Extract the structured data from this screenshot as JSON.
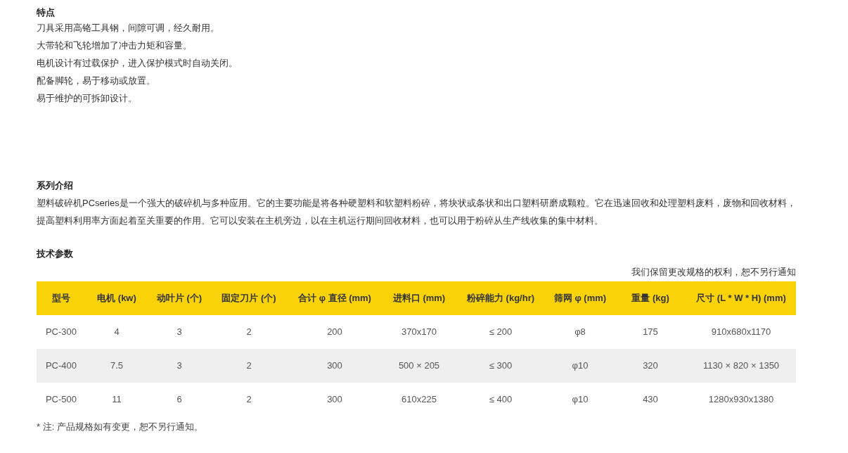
{
  "features": {
    "heading": "特点",
    "items": [
      "刀具采用高铬工具钢，间隙可调，经久耐用。",
      "大带轮和飞轮增加了冲击力矩和容量。",
      "电机设计有过载保护，进入保护模式时自动关闭。",
      "配备脚轮，易于移动或放置。",
      "易于维护的可拆卸设计。"
    ]
  },
  "intro": {
    "heading": "系列介绍",
    "text": "塑料破碎机PCseries是一个强大的破碎机与多种应用。它的主要功能是将各种硬塑料和软塑料粉碎，将块状或条状和出口塑料研磨成颗粒。它在迅速回收和处理塑料废料，废物和回收材料，提高塑料利用率方面起着至关重要的作用。它可以安装在主机旁边，以在主机运行期间回收材料，也可以用于粉碎从生产线收集的集中材料。"
  },
  "specs": {
    "heading": "技术参数",
    "notice": "我们保留更改规格的权利，恕不另行通知",
    "table": {
      "columns": [
        "型号",
        "电机 (kw)",
        "动叶片 (个)",
        "固定刀片 (个)",
        "合计 φ 直径 (mm)",
        "进料口 (mm)",
        "粉碎能力 (kg/hr)",
        "筛网 φ (mm)",
        "重量 (kg)",
        "尺寸 (L * W * H) (mm)"
      ],
      "rows": [
        [
          "PC-300",
          "4",
          "3",
          "2",
          "200",
          "370x170",
          "≤ 200",
          "φ8",
          "175",
          "910x680x1170"
        ],
        [
          "PC-400",
          "7.5",
          "3",
          "2",
          "300",
          "500 × 205",
          "≤ 300",
          "φ10",
          "320",
          "1130 × 820 × 1350"
        ],
        [
          "PC-500",
          "11",
          "6",
          "2",
          "300",
          "610x225",
          "≤ 400",
          "φ10",
          "430",
          "1280x930x1380"
        ]
      ]
    },
    "footnote": "* 注: 产品规格如有变更，恕不另行通知。"
  }
}
